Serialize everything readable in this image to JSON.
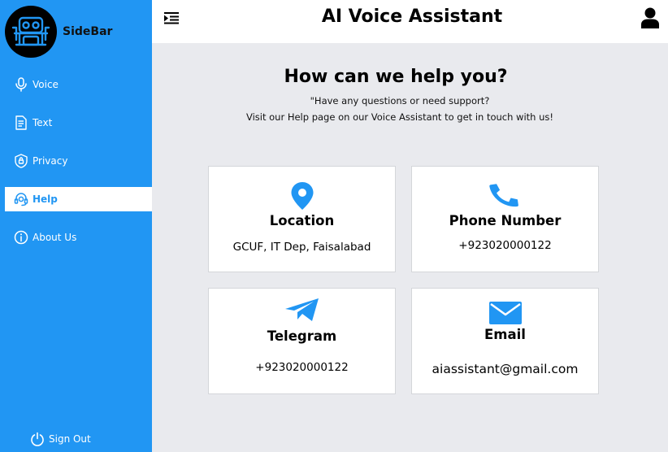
{
  "sidebar": {
    "brand": "SideBar",
    "items": [
      {
        "label": "Voice",
        "icon": "microphone-icon"
      },
      {
        "label": "Text",
        "icon": "document-icon"
      },
      {
        "label": "Privacy",
        "icon": "shield-lock-icon"
      },
      {
        "label": "Help",
        "icon": "headset-icon",
        "active": true
      },
      {
        "label": "About Us",
        "icon": "info-icon"
      }
    ],
    "signout": "Sign Out",
    "color": "#2196f3"
  },
  "header": {
    "title": "AI Voice Assistant"
  },
  "main": {
    "title": "How can we help you?",
    "subtitle_line1": "\"Have any questions or need support?",
    "subtitle_line2": "Visit our Help page on our Voice Assistant to get in touch with us!",
    "cards": [
      {
        "title": "Location",
        "value": "GCUF, IT Dep, Faisalabad",
        "icon": "location-pin-icon"
      },
      {
        "title": "Phone Number",
        "value": "+923020000122",
        "icon": "phone-icon"
      },
      {
        "title": "Telegram",
        "value": "+923020000122",
        "icon": "telegram-icon"
      },
      {
        "title": "Email",
        "value": "aiassistant@gmail.com",
        "icon": "envelope-icon"
      }
    ]
  }
}
